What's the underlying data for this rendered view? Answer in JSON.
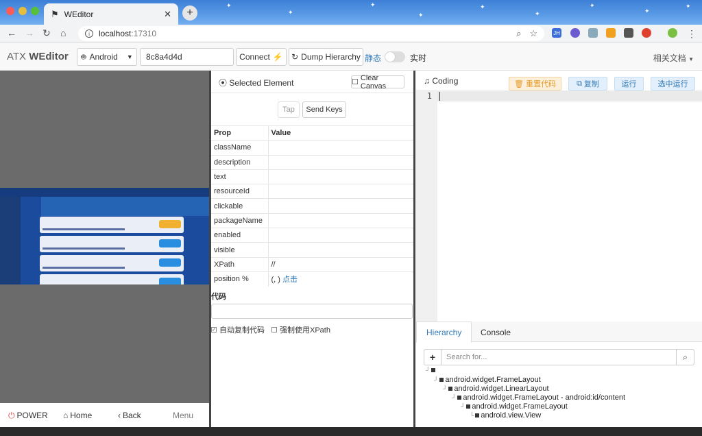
{
  "browser": {
    "tab_title": "WEditor",
    "url_host": "localhost",
    "url_port": ":17310",
    "ext_labels": [
      "JH"
    ]
  },
  "app": {
    "brand_prefix": "ATX ",
    "brand_name": "WEditor",
    "platform": "Android",
    "device_id": "8c8a4d4d",
    "connect_label": "Connect",
    "dump_label": "Dump Hierarchy",
    "static_label": "静态",
    "realtime_label": "实时",
    "docs_label": "相关文档"
  },
  "device_bar": {
    "power": "POWER",
    "home": "Home",
    "back": "Back",
    "menu": "Menu"
  },
  "inspector": {
    "selected_label": "Selected Element",
    "clear_label": "Clear Canvas",
    "tap_label": "Tap",
    "send_keys_label": "Send Keys",
    "col_prop": "Prop",
    "col_value": "Value",
    "rows": [
      {
        "prop": "className",
        "value": ""
      },
      {
        "prop": "description",
        "value": ""
      },
      {
        "prop": "text",
        "value": ""
      },
      {
        "prop": "resourceId",
        "value": ""
      },
      {
        "prop": "clickable",
        "value": ""
      },
      {
        "prop": "packageName",
        "value": ""
      },
      {
        "prop": "enabled",
        "value": ""
      },
      {
        "prop": "visible",
        "value": ""
      },
      {
        "prop": "XPath",
        "value": "//"
      },
      {
        "prop": "position %",
        "value": "(, )"
      }
    ],
    "position_link": "点击",
    "code_label": "代码",
    "auto_copy_label": "自动复制代码",
    "force_xpath_label": "强制使用XPath"
  },
  "coding": {
    "label": "Coding",
    "reset_label": "重置代码",
    "copy_label": "复制",
    "run_label": "运行",
    "run_selected_label": "选中运行",
    "line_number": "1"
  },
  "bottom_tabs": {
    "hierarchy": "Hierarchy",
    "console": "Console",
    "search_placeholder": "Search for..."
  },
  "tree": [
    {
      "label": ""
    },
    {
      "label": "android.widget.FrameLayout"
    },
    {
      "label": "android.widget.LinearLayout"
    },
    {
      "label": "android.widget.FrameLayout - android:id/content"
    },
    {
      "label": "android.widget.FrameLayout"
    },
    {
      "label": "android.view.View"
    }
  ]
}
